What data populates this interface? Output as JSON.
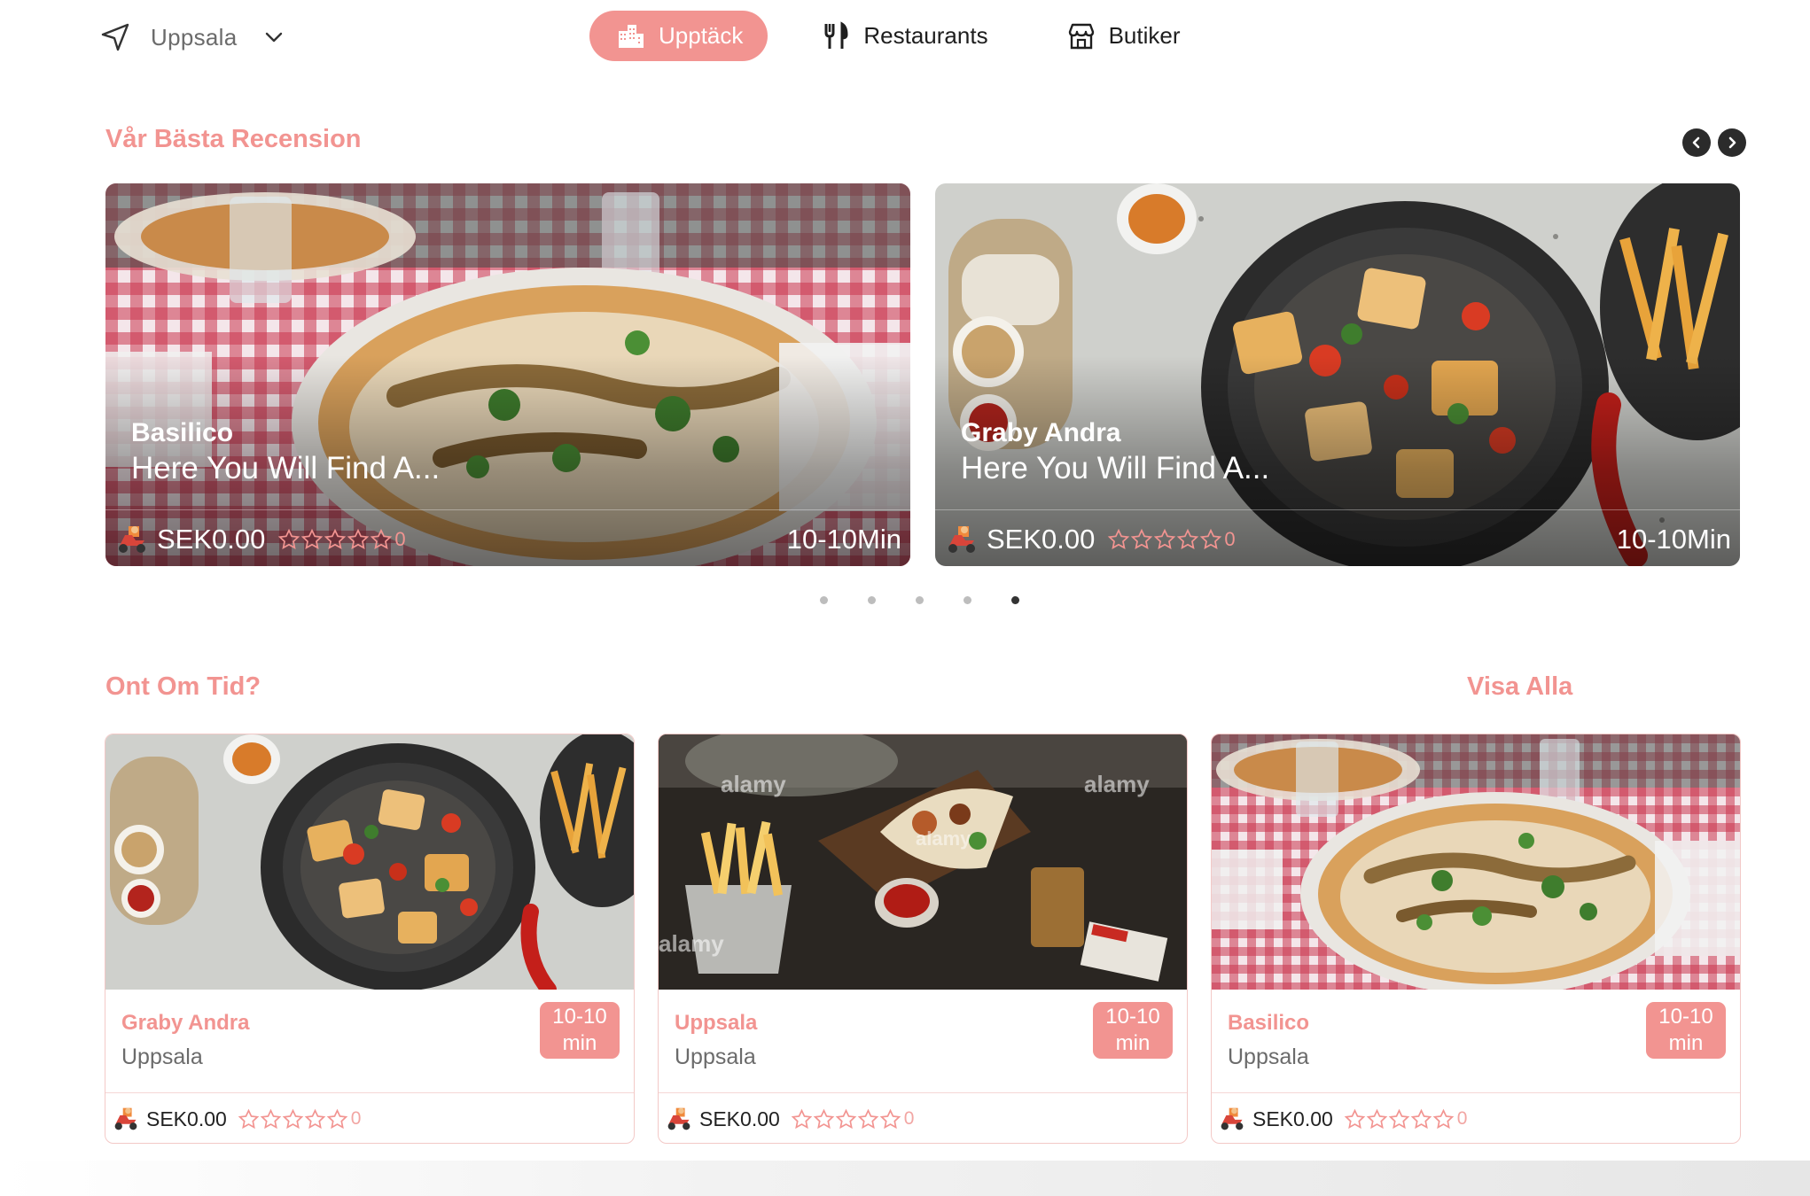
{
  "location": {
    "city": "Uppsala"
  },
  "nav": {
    "tabs": [
      {
        "label": "Upptäck",
        "icon": "city-icon",
        "active": true
      },
      {
        "label": "Restaurants",
        "icon": "fork-knife-icon",
        "active": false
      },
      {
        "label": "Butiker",
        "icon": "store-icon",
        "active": false
      }
    ]
  },
  "featured": {
    "title": "Vår Bästa Recension",
    "cards": [
      {
        "name": "Basilico",
        "description": "Here You Will Find A...",
        "price": "SEK0.00",
        "rating": "0",
        "time": "10-10Min",
        "image": "pizza"
      },
      {
        "name": "Graby Andra",
        "description": "Here You Will Find A...",
        "price": "SEK0.00",
        "rating": "0",
        "time": "10-10Min",
        "image": "tofu-bowl"
      }
    ],
    "dots": 5,
    "active_dot": 5
  },
  "quick": {
    "title": "Ont Om Tid?",
    "view_all": "Visa Alla",
    "cards": [
      {
        "name": "Graby Andra",
        "city": "Uppsala",
        "time_line1": "10-10",
        "time_line2": "min",
        "price": "SEK0.00",
        "rating": "0",
        "image": "tofu-bowl"
      },
      {
        "name": "Uppsala",
        "city": "Uppsala",
        "time_line1": "10-10",
        "time_line2": "min",
        "price": "SEK0.00",
        "rating": "0",
        "image": "fries-tacos"
      },
      {
        "name": "Basilico",
        "city": "Uppsala",
        "time_line1": "10-10",
        "time_line2": "min",
        "price": "SEK0.00",
        "rating": "0",
        "image": "pizza"
      }
    ]
  },
  "colors": {
    "accent": "#f29491",
    "text": "#1e1e1e",
    "muted": "#6b6b6b"
  }
}
